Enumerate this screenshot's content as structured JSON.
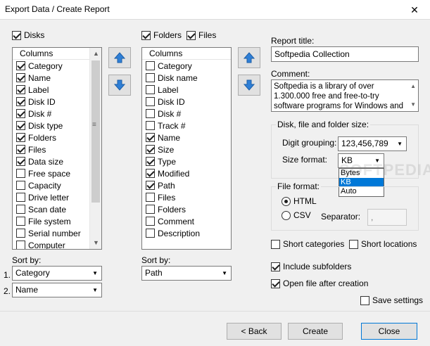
{
  "window": {
    "title": "Export Data / Create Report",
    "close_glyph": "✕"
  },
  "left": {
    "disks_label": "Disks",
    "column_header": "Columns",
    "items": [
      {
        "label": "Category",
        "checked": true
      },
      {
        "label": "Name",
        "checked": true
      },
      {
        "label": "Label",
        "checked": true
      },
      {
        "label": "Disk ID",
        "checked": true
      },
      {
        "label": "Disk #",
        "checked": true
      },
      {
        "label": "Disk type",
        "checked": true
      },
      {
        "label": "Folders",
        "checked": true
      },
      {
        "label": "Files",
        "checked": true
      },
      {
        "label": "Data size",
        "checked": true
      },
      {
        "label": "Free space",
        "checked": false
      },
      {
        "label": "Capacity",
        "checked": false
      },
      {
        "label": "Drive letter",
        "checked": false
      },
      {
        "label": "Scan date",
        "checked": false
      },
      {
        "label": "File system",
        "checked": false
      },
      {
        "label": "Serial number",
        "checked": false
      },
      {
        "label": "Computer",
        "checked": false
      }
    ],
    "sort_by_label": "Sort by:",
    "sort1_index": "1.",
    "sort1_value": "Category",
    "sort2_index": "2.",
    "sort2_value": "Name"
  },
  "middle": {
    "folders_label": "Folders",
    "files_label": "Files",
    "column_header": "Columns",
    "items": [
      {
        "label": "Category",
        "checked": false
      },
      {
        "label": "Disk name",
        "checked": false
      },
      {
        "label": "Label",
        "checked": false
      },
      {
        "label": "Disk ID",
        "checked": false
      },
      {
        "label": "Disk #",
        "checked": false
      },
      {
        "label": "Track #",
        "checked": false
      },
      {
        "label": "Name",
        "checked": true
      },
      {
        "label": "Size",
        "checked": true
      },
      {
        "label": "Type",
        "checked": true
      },
      {
        "label": "Modified",
        "checked": true
      },
      {
        "label": "Path",
        "checked": true
      },
      {
        "label": "Files",
        "checked": false
      },
      {
        "label": "Folders",
        "checked": false
      },
      {
        "label": "Comment",
        "checked": false
      },
      {
        "label": "Description",
        "checked": false
      }
    ],
    "sort_by_label": "Sort by:",
    "sort_value": "Path"
  },
  "right": {
    "report_title_label": "Report title:",
    "report_title_value": "Softpedia Collection",
    "comment_label": "Comment:",
    "comment_value": "Softpedia is a library of over 1.300.000 free and free-to-try software programs for Windows and Linux, games, Mac",
    "size_group_title": "Disk, file and folder size:",
    "digit_grouping_label": "Digit grouping:",
    "digit_grouping_value": "123,456,789",
    "size_format_label": "Size format:",
    "size_format_value": "KB",
    "size_format_options": [
      "Bytes",
      "KB",
      "Auto"
    ],
    "file_format_title": "File format:",
    "html_label": "HTML",
    "csv_label": "CSV",
    "separator_label": "Separator:",
    "separator_value": ",",
    "short_categories_label": "Short categories",
    "short_locations_label": "Short locations",
    "include_subfolders_label": "Include subfolders",
    "open_file_label": "Open file after creation",
    "save_settings_label": "Save settings"
  },
  "buttons": {
    "back": "< Back",
    "create": "Create",
    "close": "Close"
  },
  "watermark": "SOFTPEDIA"
}
